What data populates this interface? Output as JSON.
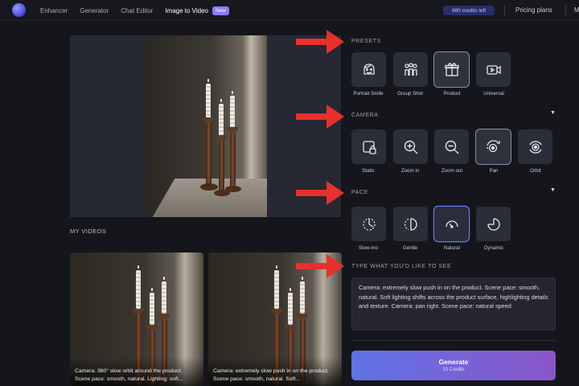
{
  "topbar": {
    "nav": [
      "Enhancer",
      "Generator",
      "Chat Editor",
      "Image to Video"
    ],
    "new_badge": "New",
    "credits": "980 credits left",
    "pricing": "Pricing plans",
    "more": "M"
  },
  "my_videos": {
    "title": "MY VIDEOS",
    "cards": [
      {
        "caption": "Camera: 360° slow orbit around the product. Scene pace: smooth, natural. Lighting: soft..."
      },
      {
        "caption": "Camera: extremely slow push in on the product. Scene pace: smooth, natural. Soft..."
      }
    ]
  },
  "presets": {
    "title": "PRESETS",
    "items": [
      {
        "label": "Portrait Smile",
        "icon": "face-icon"
      },
      {
        "label": "Group Shot",
        "icon": "group-icon"
      },
      {
        "label": "Product",
        "icon": "gift-icon"
      },
      {
        "label": "Universal",
        "icon": "video-icon"
      }
    ]
  },
  "camera": {
    "title": "CAMERA",
    "items": [
      {
        "label": "Static",
        "icon": "lock-frame-icon"
      },
      {
        "label": "Zoom in",
        "icon": "zoom-in-icon"
      },
      {
        "label": "Zoom out",
        "icon": "zoom-out-icon"
      },
      {
        "label": "Pan",
        "icon": "pan-icon"
      },
      {
        "label": "Orbit",
        "icon": "orbit-icon"
      }
    ]
  },
  "pace": {
    "title": "PACE",
    "items": [
      {
        "label": "Slow-mo",
        "icon": "slowmo-icon"
      },
      {
        "label": "Gentle",
        "icon": "gentle-icon"
      },
      {
        "label": "Natural",
        "icon": "natural-icon"
      },
      {
        "label": "Dynamic",
        "icon": "dynamic-icon"
      }
    ]
  },
  "prompt": {
    "title": "TYPE WHAT YOU'D LIKE TO SEE",
    "value": "Camera: extremely slow push in on the product. Scene pace: smooth, natural. Soft lighting shifts across the product surface, highlighting details and texture. Camera: pan right. Scene pace: natural speed"
  },
  "generate": {
    "label": "Generate",
    "cost": "10 Credits"
  },
  "colors": {
    "accent": "#5b7cff",
    "annotation_arrow": "#e8302c",
    "generate_from": "#5f72e6",
    "generate_to": "#8a56c9"
  }
}
